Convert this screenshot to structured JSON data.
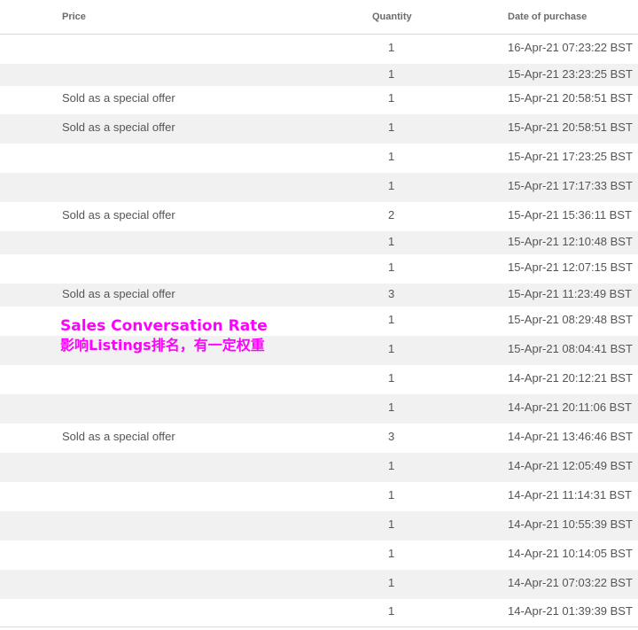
{
  "header": {
    "price": "Price",
    "quantity": "Quantity",
    "date": "Date of purchase"
  },
  "rows": [
    {
      "price": "",
      "quantity": "1",
      "date": "16-Apr-21 07:23:22 BST"
    },
    {
      "price": "",
      "quantity": "1",
      "date": "15-Apr-21 23:23:25 BST"
    },
    {
      "price": "Sold as a special offer",
      "quantity": "1",
      "date": "15-Apr-21 20:58:51 BST"
    },
    {
      "price": "Sold as a special offer",
      "quantity": "1",
      "date": "15-Apr-21 20:58:51 BST"
    },
    {
      "price": "",
      "quantity": "1",
      "date": "15-Apr-21 17:23:25 BST"
    },
    {
      "price": "",
      "quantity": "1",
      "date": "15-Apr-21 17:17:33 BST"
    },
    {
      "price": "Sold as a special offer",
      "quantity": "2",
      "date": "15-Apr-21 15:36:11 BST"
    },
    {
      "price": "",
      "quantity": "1",
      "date": "15-Apr-21 12:10:48 BST"
    },
    {
      "price": "",
      "quantity": "1",
      "date": "15-Apr-21 12:07:15 BST"
    },
    {
      "price": "Sold as a special offer",
      "quantity": "3",
      "date": "15-Apr-21 11:23:49 BST"
    },
    {
      "price": "",
      "quantity": "1",
      "date": "15-Apr-21 08:29:48 BST"
    },
    {
      "price": "",
      "quantity": "1",
      "date": "15-Apr-21 08:04:41 BST"
    },
    {
      "price": "",
      "quantity": "1",
      "date": "14-Apr-21 20:12:21 BST"
    },
    {
      "price": "",
      "quantity": "1",
      "date": "14-Apr-21 20:11:06 BST"
    },
    {
      "price": "Sold as a special offer",
      "quantity": "3",
      "date": "14-Apr-21 13:46:46 BST"
    },
    {
      "price": "",
      "quantity": "1",
      "date": "14-Apr-21 12:05:49 BST"
    },
    {
      "price": "",
      "quantity": "1",
      "date": "14-Apr-21 11:14:31 BST"
    },
    {
      "price": "",
      "quantity": "1",
      "date": "14-Apr-21 10:55:39 BST"
    },
    {
      "price": "",
      "quantity": "1",
      "date": "14-Apr-21 10:14:05 BST"
    },
    {
      "price": "",
      "quantity": "1",
      "date": "14-Apr-21 07:03:22 BST"
    },
    {
      "price": "",
      "quantity": "1",
      "date": "14-Apr-21 01:39:39 BST"
    }
  ],
  "annotation": {
    "line1": "Sales Conversation Rate",
    "line2": "影响Listings排名，有一定权重",
    "color": "#ff00ff"
  }
}
